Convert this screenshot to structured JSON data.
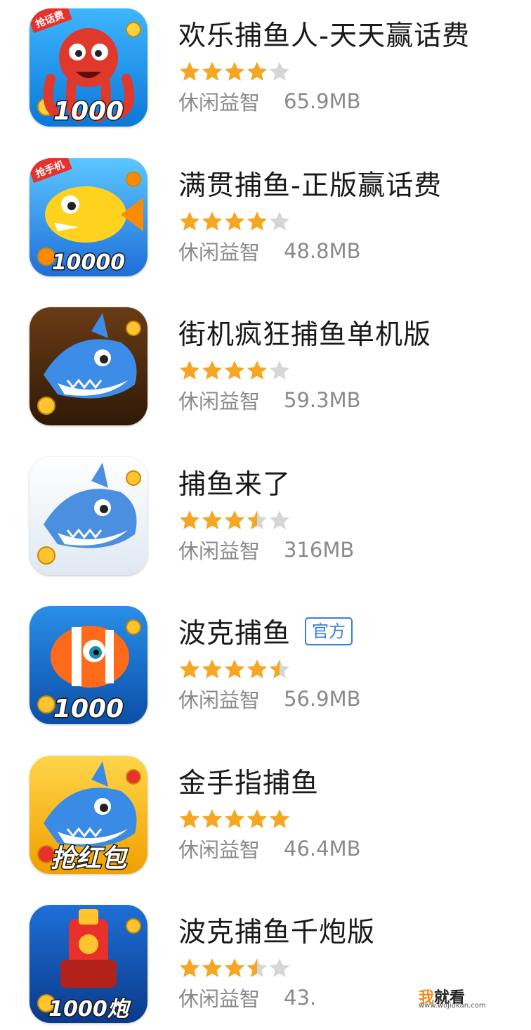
{
  "colors": {
    "star_filled": "#f5a623",
    "star_empty": "#d6d6d6",
    "badge": "#3a7ee0",
    "title": "#1a1a1a",
    "meta": "#8a8a8a"
  },
  "apps": [
    {
      "title": "欢乐捕鱼人-天天赢话费",
      "rating": 4,
      "category": "休闲益智",
      "size": "65.9MB",
      "badge": "",
      "icon": "red-octopus-1000-icon",
      "icon_text": "1000",
      "icon_corner": "抢话费"
    },
    {
      "title": "满贯捕鱼-正版赢话费",
      "rating": 4,
      "category": "休闲益智",
      "size": "48.8MB",
      "badge": "",
      "icon": "yellow-fish-10000-icon",
      "icon_text": "10000",
      "icon_corner": "抢手机"
    },
    {
      "title": "街机疯狂捕鱼单机版",
      "rating": 4,
      "category": "休闲益智",
      "size": "59.3MB",
      "badge": "",
      "icon": "blue-shark-coins-icon",
      "icon_text": "",
      "icon_corner": ""
    },
    {
      "title": "捕鱼来了",
      "rating": 3.5,
      "category": "休闲益智",
      "size": "316MB",
      "badge": "",
      "icon": "shark-treasure-chest-icon",
      "icon_text": "",
      "icon_corner": ""
    },
    {
      "title": "波克捕鱼",
      "rating": 4.5,
      "category": "休闲益智",
      "size": "56.9MB",
      "badge": "官方",
      "icon": "clownfish-1000-icon",
      "icon_text": "1000",
      "icon_corner": ""
    },
    {
      "title": "金手指捕鱼",
      "rating": 5,
      "category": "休闲益智",
      "size": "46.4MB",
      "badge": "",
      "icon": "shark-red-envelope-icon",
      "icon_text": "抢红包",
      "icon_corner": ""
    },
    {
      "title": "波克捕鱼千炮版",
      "rating": 3.5,
      "category": "休闲益智",
      "size": "43.",
      "badge": "",
      "icon": "cannon-1000-icon",
      "icon_text": "1000炮",
      "icon_corner": ""
    }
  ],
  "watermark": {
    "brand_w": "我",
    "brand_rest": "就看",
    "url": "www.wojiukan.com"
  }
}
